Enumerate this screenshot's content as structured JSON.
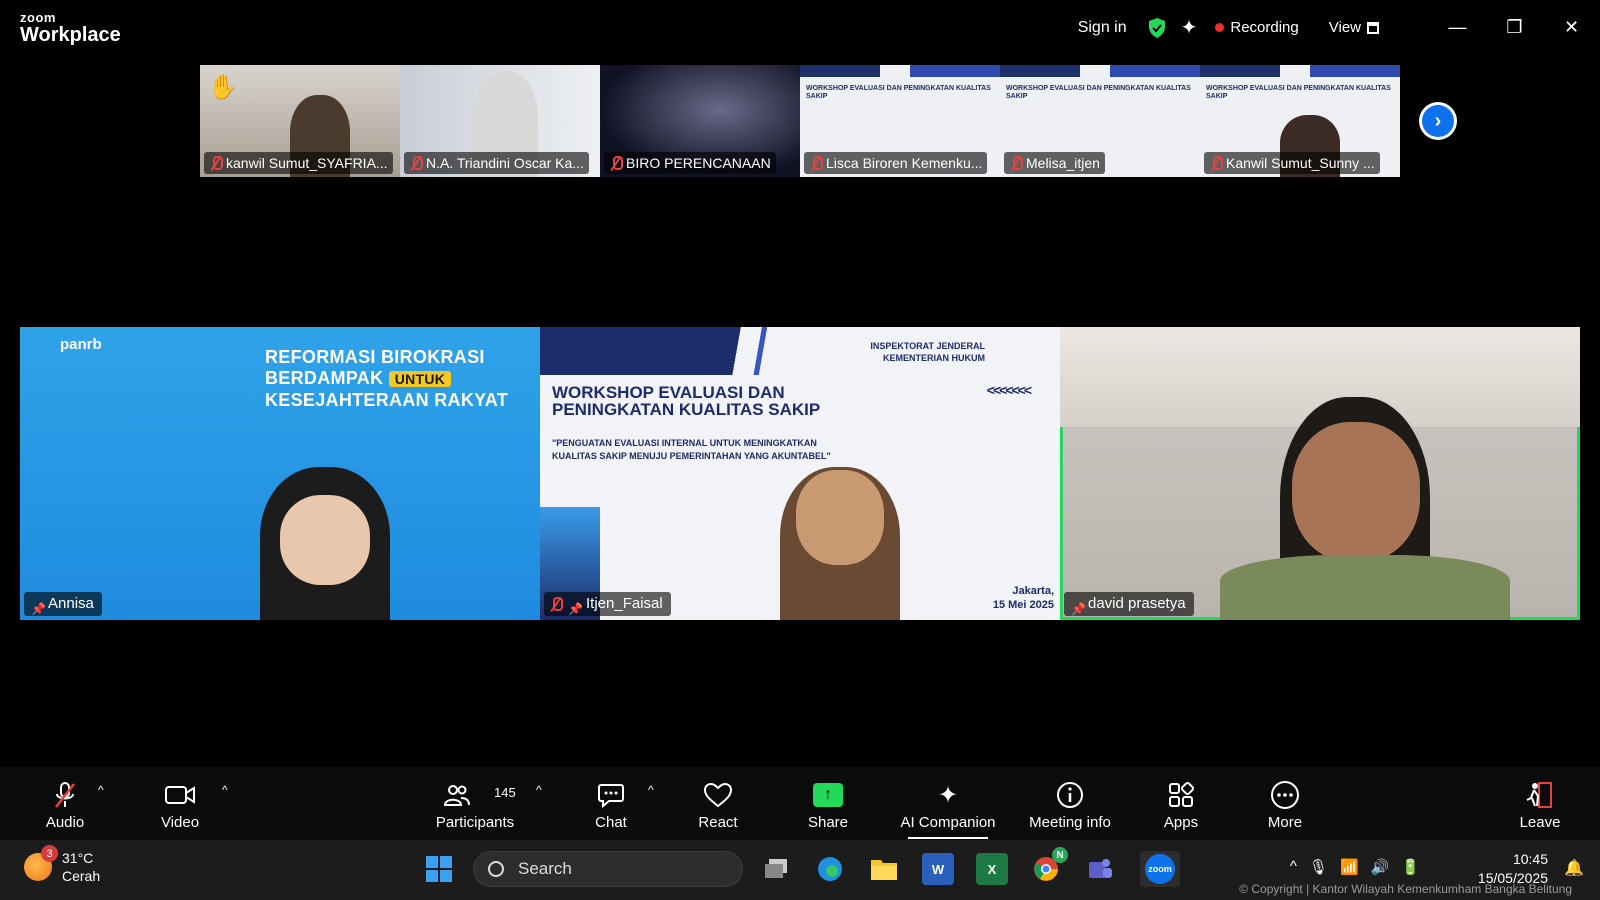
{
  "app": {
    "brand_top": "zoom",
    "brand_bottom": "Workplace"
  },
  "titlebar": {
    "signin": "Sign in",
    "recording": "Recording",
    "view": "View",
    "minimize": "—",
    "restore": "❐",
    "close": "✕"
  },
  "thumbnails": [
    {
      "name": "kanwil Sumut_SYAFRIA..."
    },
    {
      "name": "N.A. Triandini Oscar Ka..."
    },
    {
      "name": "BIRO PERENCANAAN"
    },
    {
      "name": "Lisca Biroren Kemenku..."
    },
    {
      "name": "Melisa_itjen"
    },
    {
      "name": "Kanwil Sumut_Sunny ..."
    }
  ],
  "slide_small_title": "WORKSHOP EVALUASI DAN PENINGKATAN KUALITAS SAKIP",
  "main_tiles": [
    {
      "name": "Annisa",
      "brand": "panrb",
      "heading_line1": "REFORMASI BIROKRASI",
      "heading_line2": "BERDAMPAK",
      "heading_tag": "UNTUK",
      "heading_line3": "KESEJAHTERAAN RAKYAT"
    },
    {
      "name": "Itjen_Faisal",
      "org_line1": "INSPEKTORAT JENDERAL",
      "org_line2": "KEMENTERIAN HUKUM",
      "title_line1": "WORKSHOP EVALUASI DAN",
      "title_line2": "PENINGKATAN KUALITAS SAKIP",
      "sub_line1": "\"PENGUATAN EVALUASI INTERNAL UNTUK MENINGKATKAN",
      "sub_line2": "KUALITAS SAKIP MENUJU PEMERINTAHAN YANG AKUNTABEL\"",
      "date_line1": "Jakarta,",
      "date_line2": "15 Mei 2025"
    },
    {
      "name": "david prasetya"
    }
  ],
  "toolbar": {
    "audio": "Audio",
    "video": "Video",
    "participants": "Participants",
    "participants_count": "145",
    "chat": "Chat",
    "react": "React",
    "share": "Share",
    "ai_companion": "AI Companion",
    "meeting_info": "Meeting info",
    "apps": "Apps",
    "more": "More",
    "leave": "Leave"
  },
  "taskbar": {
    "weather_temp": "31°C",
    "weather_desc": "Cerah",
    "weather_badge": "3",
    "search_placeholder": "Search",
    "chrome_badge": "N",
    "zoom_label": "zoom",
    "time": "10:45",
    "date": "15/05/2025",
    "copyright": "© Copyright | Kantor Wilayah Kemenkumham Bangka Belitung"
  },
  "colors": {
    "active_speaker": "#23d959",
    "zoom_blue": "#0e72ed",
    "recording_red": "#f02b2b"
  }
}
